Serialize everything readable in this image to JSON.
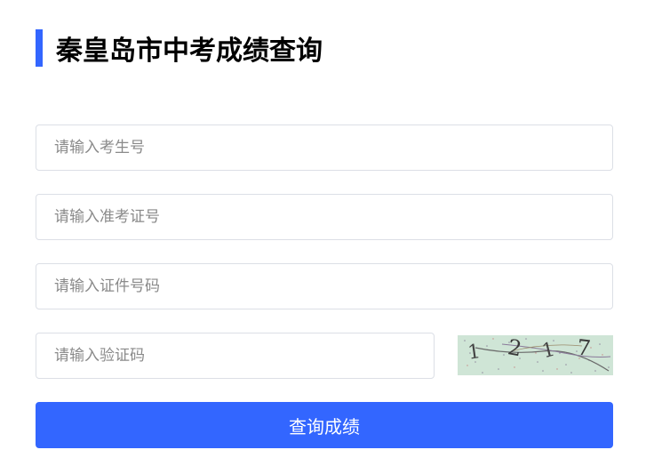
{
  "page": {
    "title": "秦皇岛市中考成绩查询"
  },
  "form": {
    "exam_number_placeholder": "请输入考生号",
    "admission_ticket_placeholder": "请输入准考证号",
    "id_number_placeholder": "请输入证件号码",
    "captcha_placeholder": "请输入验证码",
    "captcha_text": "1 2 1 7",
    "submit_label": "查询成绩"
  },
  "colors": {
    "accent": "#3366ff",
    "captcha_bg": "#cfe5d6",
    "input_border": "#dcdfe6",
    "placeholder": "#8a8a8a"
  },
  "icons": {
    "title_marker": "vertical-accent-bar"
  }
}
